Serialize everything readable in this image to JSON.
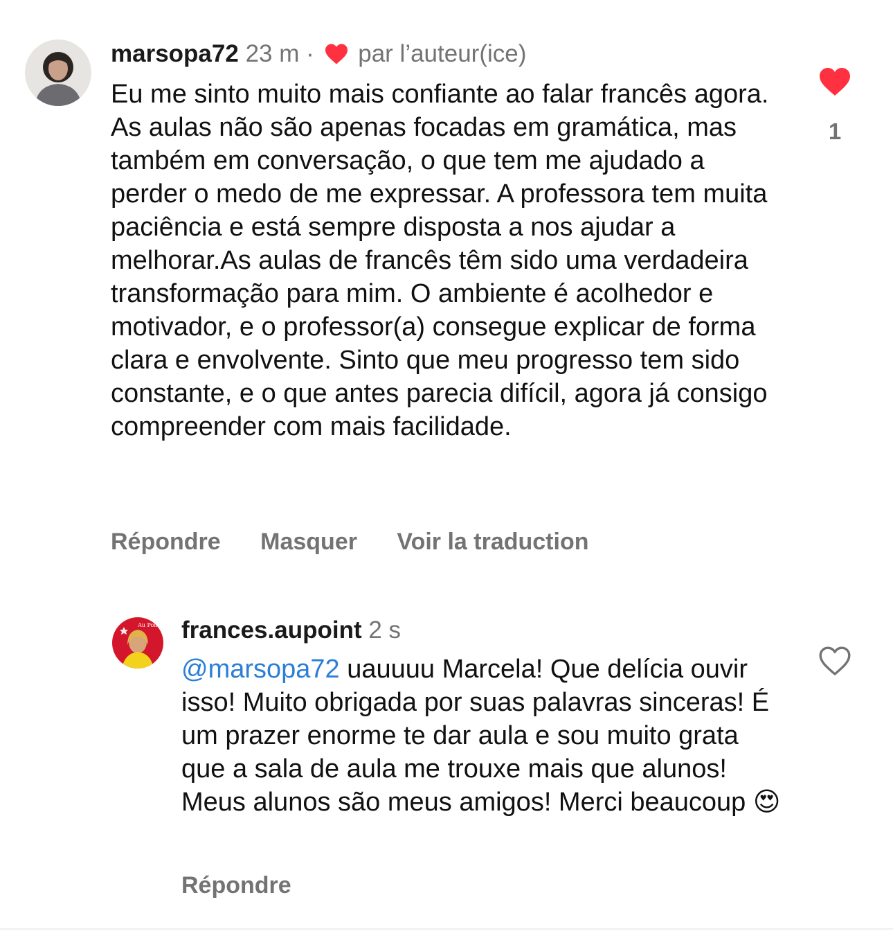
{
  "comment": {
    "username": "marsopa72",
    "time": "23 m",
    "separator": "·",
    "by_author": "par l’auteur(ice)",
    "text": "Eu me sinto muito mais confiante ao falar francês agora. As aulas não são apenas focadas em gramática, mas também em conversação, o que tem me ajudado a perder o medo de me expressar. A professora tem muita paciência e está sempre disposta a nos ajudar a melhorar.As aulas de francês têm sido uma verdadeira transformação para mim. O ambiente é acolhedor e motivador, e o professor(a) consegue explicar de forma clara e envolvente. Sinto que meu progresso tem sido constante, e o que antes parecia difícil, agora já consigo compreender com mais facilidade.",
    "like_count": "1",
    "actions": {
      "reply": "Répondre",
      "hide": "Masquer",
      "translate": "Voir la traduction"
    }
  },
  "reply": {
    "username": "frances.aupoint",
    "time": "2 s",
    "mention": "@marsopa72",
    "text": " uauuuu Marcela! Que delícia ouvir isso! Muito obrigada por suas palavras sinceras! É um prazer enorme te dar aula e sou muito grata que a sala de aula me trouxe mais que alunos! Meus alunos são meus amigos! Merci beaucoup 😍",
    "avatar_badge": "Au Point",
    "actions": {
      "reply": "Répondre"
    }
  },
  "colors": {
    "like_red": "#ff3040",
    "mention_blue": "#2b7fd6",
    "muted_gray": "#737373"
  }
}
